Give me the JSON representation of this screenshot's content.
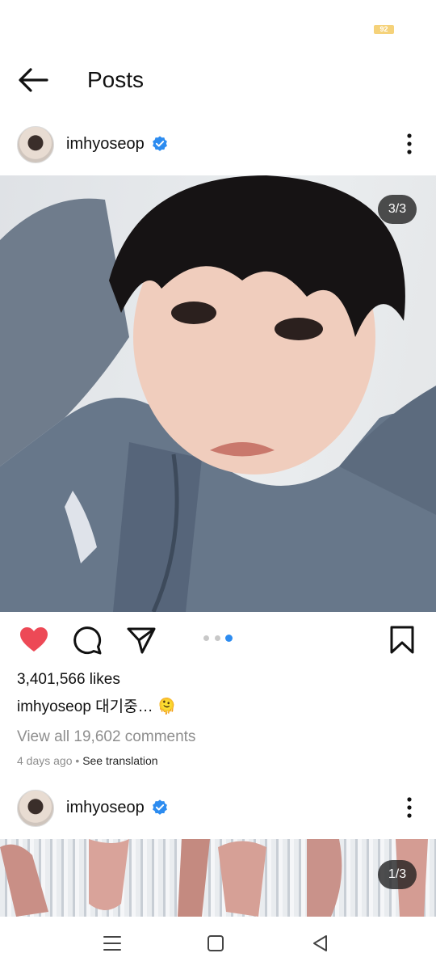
{
  "status_bar": {
    "battery": "92"
  },
  "header": {
    "title": "Posts",
    "back_icon": "arrow-left-icon"
  },
  "posts": [
    {
      "username": "imhyoseop",
      "verified": true,
      "carousel_counter": "3/3",
      "likes": "3,401,566 likes",
      "caption_username": "imhyoseop",
      "caption_text": "대기중… 🫠",
      "comments_link": "View all 19,602 comments",
      "time": "4 days ago",
      "separator": "•",
      "translate_link": "See translation",
      "liked": true,
      "carousel_dots": 3,
      "active_dot": 3
    },
    {
      "username": "imhyoseop",
      "verified": true,
      "carousel_counter": "1/3"
    }
  ],
  "icons": {
    "like": "heart-icon",
    "comment": "comment-icon",
    "share": "send-icon",
    "save": "bookmark-icon",
    "more": "more-vertical-icon"
  },
  "colors": {
    "like": "#ed4956",
    "verified": "#2d8cf0",
    "active_dot": "#2d8cf0",
    "muted": "#8e8e8e"
  },
  "nav": {
    "recent_icon": "menu-icon",
    "home_icon": "home-square-icon",
    "back_icon": "back-triangle-icon"
  }
}
